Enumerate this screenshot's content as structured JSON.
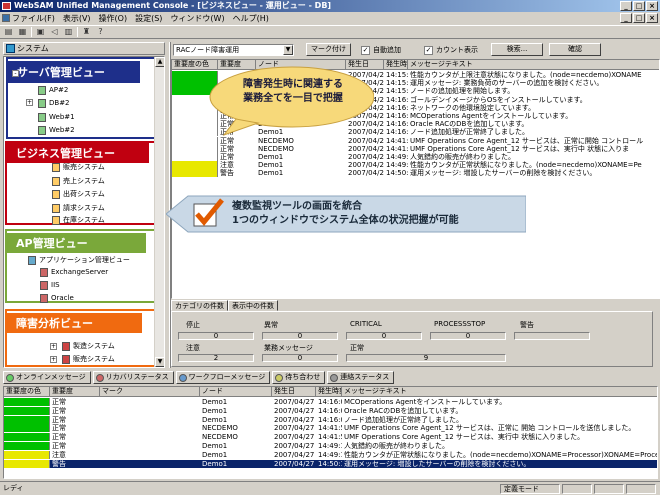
{
  "window": {
    "title": "WebSAM Unified Management Console - [ビジネスビュー - 運用ビュー - DB]"
  },
  "menu": [
    "ファイル(F)",
    "表示(V)",
    "操作(O)",
    "設定(S)",
    "ウィンドウ(W)",
    "ヘルプ(H)"
  ],
  "left": {
    "header": "システム",
    "callouts": {
      "server": "サーバ管理ビュー",
      "business": "ビジネス管理ビュー",
      "ap": "AP管理ビュー",
      "failure": "障害分析ビュー"
    },
    "nodes": [
      "AP#2",
      "DB#2",
      "Web#1",
      "Web#2",
      "販売システム",
      "売上システム",
      "出荷システム",
      "請求システム",
      "在庫システム",
      "アプリケーション管理ビュー",
      "ExchangeServer",
      "IIS",
      "Oracle",
      "製造システム",
      "販売システム"
    ]
  },
  "annotations": {
    "balloon_line1": "障害発生時に関連する",
    "balloon_line2": "業務全てを一目で把握",
    "banner_line1": "複数監視ツールの画面を統合",
    "banner_line2": "1つのウィンドウでシステム全体の状況把握が可能"
  },
  "topbar": {
    "combo": "RACノード障害運用",
    "mark_button": "マーク付け",
    "auto_add": "自動追加",
    "count_display": "カウント表示",
    "search_button": "検索...",
    "confirm_button": "確認"
  },
  "grid_top": {
    "columns": [
      "重要度の色",
      "重要度",
      "ノード",
      "発生日",
      "発生時刻",
      "メッセージテキスト"
    ],
    "rows": [
      {
        "color": "#00c000",
        "sev": "",
        "node": "",
        "date": "2007/04/27",
        "time": "14:15:45",
        "text": "性能カウンタが上限注意状態になりました。(node=necdemo)XONAME"
      },
      {
        "color": "#00c000",
        "sev": "",
        "node": "",
        "date": "2007/04/27",
        "time": "14:15:55",
        "text": "運用メッセージ: 業務負荷のサーバーの追加を検討ください。"
      },
      {
        "color": "#00c000",
        "sev": "",
        "node": "",
        "date": "2007/04/27",
        "time": "14:15:55",
        "text": "ノードの追加処理を開始します。"
      },
      {
        "color": "#ffffff",
        "sev": "",
        "node": "",
        "date": "2007/04/27",
        "time": "14:16:05",
        "text": "ゴールデンイメージからOSをインストールしています。"
      },
      {
        "color": "#ffffff",
        "sev": "",
        "node": "",
        "date": "2007/04/27",
        "time": "14:16:05",
        "text": "ネットワークの他環境設定しています。"
      },
      {
        "color": "#ffffff",
        "sev": "正常",
        "node": "Demo1",
        "date": "2007/04/27",
        "time": "14:16:05",
        "text": "MCOperations Agentをインストールしています。"
      },
      {
        "color": "#ffffff",
        "sev": "正常",
        "node": "Demo1",
        "date": "2007/04/27",
        "time": "14:16:05",
        "text": "Oracle RACのDBを追加しています。"
      },
      {
        "color": "#ffffff",
        "sev": "正常",
        "node": "Demo1",
        "date": "2007/04/27",
        "time": "14:16:05",
        "text": "ノード追加処理が正常終了しました。"
      },
      {
        "color": "#ffffff",
        "sev": "正常",
        "node": "NECDEMO",
        "date": "2007/04/27",
        "time": "14:41:51",
        "text": "UMF Operations Core Agent_12 サービスは、正常に開始 コントロール"
      },
      {
        "color": "#ffffff",
        "sev": "正常",
        "node": "NECDEMO",
        "date": "2007/04/27",
        "time": "14:41:51",
        "text": "UMF Operations Core Agent_12 サービスは、実行中 状態に入りま"
      },
      {
        "color": "#ffffff",
        "sev": "正常",
        "node": "Demo1",
        "date": "2007/04/27",
        "time": "14:49:16",
        "text": "人気錯約の販売が終わりました。"
      },
      {
        "color": "#e8e800",
        "sev": "注意",
        "node": "Demo1",
        "date": "2007/04/27",
        "time": "14:49:16",
        "text": "性能カウンタが正常状態になりました。(node=necdemo)XONAME=Pe"
      },
      {
        "color": "#e8e800",
        "sev": "警告",
        "node": "Demo1",
        "date": "2007/04/27",
        "time": "14:50:16",
        "text": "運用メッセージ: 増設したサーバーの削除を検討ください。"
      }
    ]
  },
  "counts": {
    "tabs": [
      "カテゴリの件数",
      "表示中の件数"
    ],
    "labels": [
      "停止",
      "異常",
      "CRITICAL",
      "PROCESSSTOP",
      "警告",
      "注意",
      "業務メッセージ",
      "正常"
    ],
    "values": [
      "0",
      "0",
      "0",
      "0",
      "",
      "2",
      "0",
      "9"
    ]
  },
  "bottom": {
    "tabs": [
      "オンラインメッセージ",
      "リカバリステータス",
      "ワークフローメッセージ",
      "待ち合わせ",
      "連絡ステータス"
    ],
    "columns": [
      "重要度の色",
      "重要度",
      "マーク",
      "ノード",
      "発生日",
      "発生時刻",
      "メッセージテキスト"
    ],
    "rows": [
      {
        "color": "#00c000",
        "sev": "正常",
        "node": "Demo1",
        "date": "2007/04/27",
        "time": "14:16:05",
        "text": "MCOperations Agentをインストールしています。"
      },
      {
        "color": "#00c000",
        "sev": "正常",
        "node": "Demo1",
        "date": "2007/04/27",
        "time": "14:16:05",
        "text": "Oracle RACのDBを追加しています。"
      },
      {
        "color": "#00c000",
        "sev": "正常",
        "node": "Demo1",
        "date": "2007/04/27",
        "time": "14:16:05",
        "text": "ノード追加処理が正常終了しました。"
      },
      {
        "color": "#00c000",
        "sev": "正常",
        "node": "NECDEMO",
        "date": "2007/04/27",
        "time": "14:41:51",
        "text": "UMF Operations Core Agent_12 サービスは、正常に 開始 コントロールを送信しました。"
      },
      {
        "color": "#00c000",
        "sev": "正常",
        "node": "NECDEMO",
        "date": "2007/04/27",
        "time": "14:41:51",
        "text": "UMF Operations Core Agent_12 サービスは、実行中 状態に入りました。"
      },
      {
        "color": "#00c000",
        "sev": "正常",
        "node": "Demo1",
        "date": "2007/04/27",
        "time": "14:49:16",
        "text": "人気錯約の販売が終わりました。"
      },
      {
        "color": "#e8e800",
        "sev": "注意",
        "node": "Demo1",
        "date": "2007/04/27",
        "time": "14:49:16",
        "text": "性能カウンタが正常状態になりました。(node=necdemo)XONAME=Processor)XONAME=Proces"
      },
      {
        "color": "#e8e800",
        "sev": "警告",
        "node": "Demo1",
        "date": "2007/04/27",
        "time": "14:50:16",
        "text": "運用メッセージ: 増設したサーバーの削除を検討ください。"
      }
    ]
  },
  "status": {
    "left": "レディ",
    "mode": "定義モード"
  },
  "colors": {
    "server": "#1e2f8a",
    "business": "#c00010",
    "ap": "#7aa83a",
    "failure": "#f06a10",
    "balloon": "#f7d97a",
    "banner": "#c9d8e6"
  }
}
